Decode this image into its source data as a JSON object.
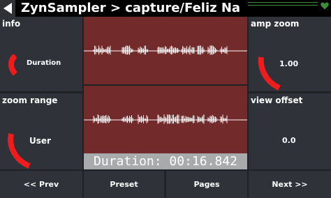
{
  "header": {
    "title": "ZynSampler > capture/Feliz Na",
    "back_icon": "triangle-left-icon",
    "status_icon": "heart-icon",
    "accent_color": "#3b8f3b"
  },
  "panels": {
    "info": {
      "title": "info",
      "value": "Duration"
    },
    "zoom_range": {
      "title": "zoom range",
      "value": "User"
    },
    "amp_zoom": {
      "title": "amp zoom",
      "value": "1.00"
    },
    "view_offset": {
      "title": "view offset",
      "value": "0.0"
    }
  },
  "waveform": {
    "background": "#722a2b",
    "line_color": "#ffffff",
    "duration_text": "Duration: 00:16.842"
  },
  "buttons": {
    "prev": "<< Prev",
    "preset": "Preset",
    "pages": "Pages",
    "next": "Next >>"
  },
  "colors": {
    "arc": "#ee1c1c",
    "panel": "#2f3339",
    "background": "#202124"
  }
}
